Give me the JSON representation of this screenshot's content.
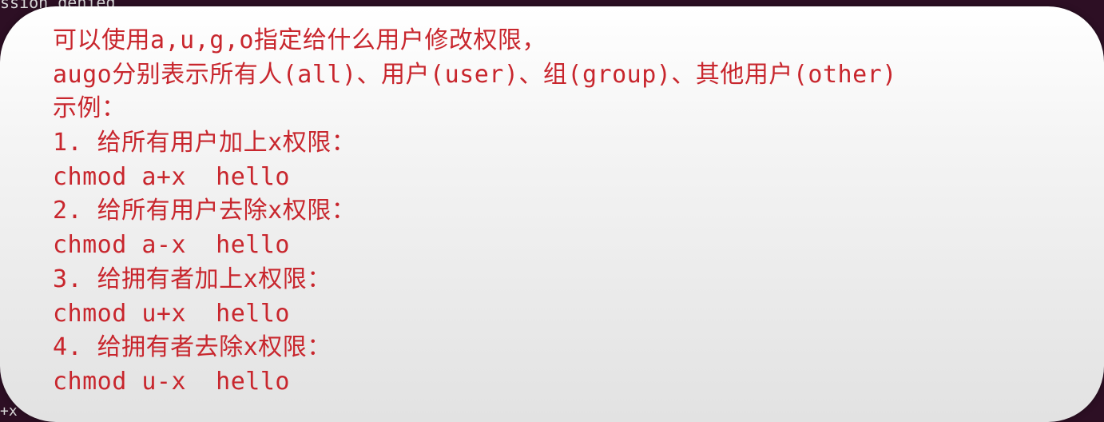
{
  "terminal": {
    "top_text": "ssion denied",
    "bottom_text": "+x"
  },
  "slide": {
    "lines": [
      "可以使用a,u,g,o指定给什么用户修改权限，",
      "augo分别表示所有人(all)、用户(user)、组(group)、其他用户(other)",
      "示例：",
      "1. 给所有用户加上x权限：",
      "chmod a+x  hello",
      "2. 给所有用户去除x权限：",
      "chmod a-x  hello",
      "3. 给拥有者加上x权限：",
      "chmod u+x  hello",
      "4. 给拥有者去除x权限：",
      "chmod u-x  hello"
    ]
  },
  "colors": {
    "text": "#c8262d",
    "slide_bg": "#f2f2f2",
    "terminal_bg": "#2d0f24"
  }
}
